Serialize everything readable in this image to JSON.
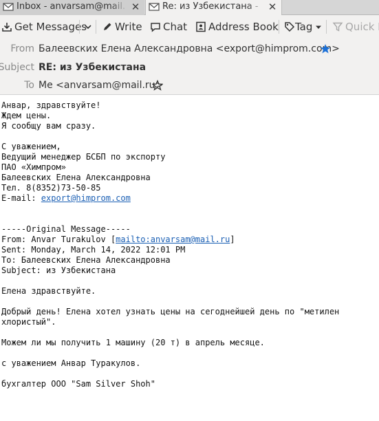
{
  "tabs": [
    {
      "label": "Inbox - anvarsam@mail.ru",
      "icon": "envelope-icon"
    },
    {
      "label": "Re: из Узбекистана - In",
      "icon": "envelope-open-icon"
    }
  ],
  "toolbar": {
    "get_messages": "Get Messages",
    "write": "Write",
    "chat": "Chat",
    "address_book": "Address Book",
    "tag": "Tag",
    "quick_filter": "Quick F"
  },
  "header": {
    "from_label": "From",
    "from_value": "Балеевских Елена Александровна <export@himprom.com>",
    "subject_label": "Subject",
    "subject_value": "RE: из Узбекистана",
    "to_label": "To",
    "to_value": "Me <anvarsam@mail.ru>"
  },
  "body": {
    "l1": "Анвар, здравствуйте!",
    "l2": "Ждем цены.",
    "l3": "Я сообщу вам сразу.",
    "l5": "С уважением,",
    "l6": "Ведущий менеджер БСБП по экспорту",
    "l7": "ПАО «Химпром»",
    "l8": "Балеевских Елена Александровна",
    "l9": "Тел. 8(8352)73-50-85",
    "l10_prefix": "E-mail: ",
    "l10_link": "export@himprom.com",
    "l13": "-----Original Message-----",
    "l14_prefix": "From: Anvar Turakulov [",
    "l14_link": "mailto:anvarsam@mail.ru",
    "l14_suffix": "]",
    "l15": "Sent: Monday, March 14, 2022 12:01 PM",
    "l16": "To: Балеевских Елена Александровна",
    "l17": "Subject: из Узбекистана",
    "l19": "Елена здравствуйте.",
    "l21": "Добрый день! Елена хотел узнать цены на сегоднейшей день по \"метилен",
    "l22": "хлористый\".",
    "l24": "Можем ли мы получить 1 машину (20 т) в апрель месяце.",
    "l26": "с уважением Анвар Туракулов.",
    "l28": "бухгалтер ООО \"Sam Silver Shoh\""
  },
  "colors": {
    "link": "#1a5fb4",
    "star": "#1c71d8"
  }
}
